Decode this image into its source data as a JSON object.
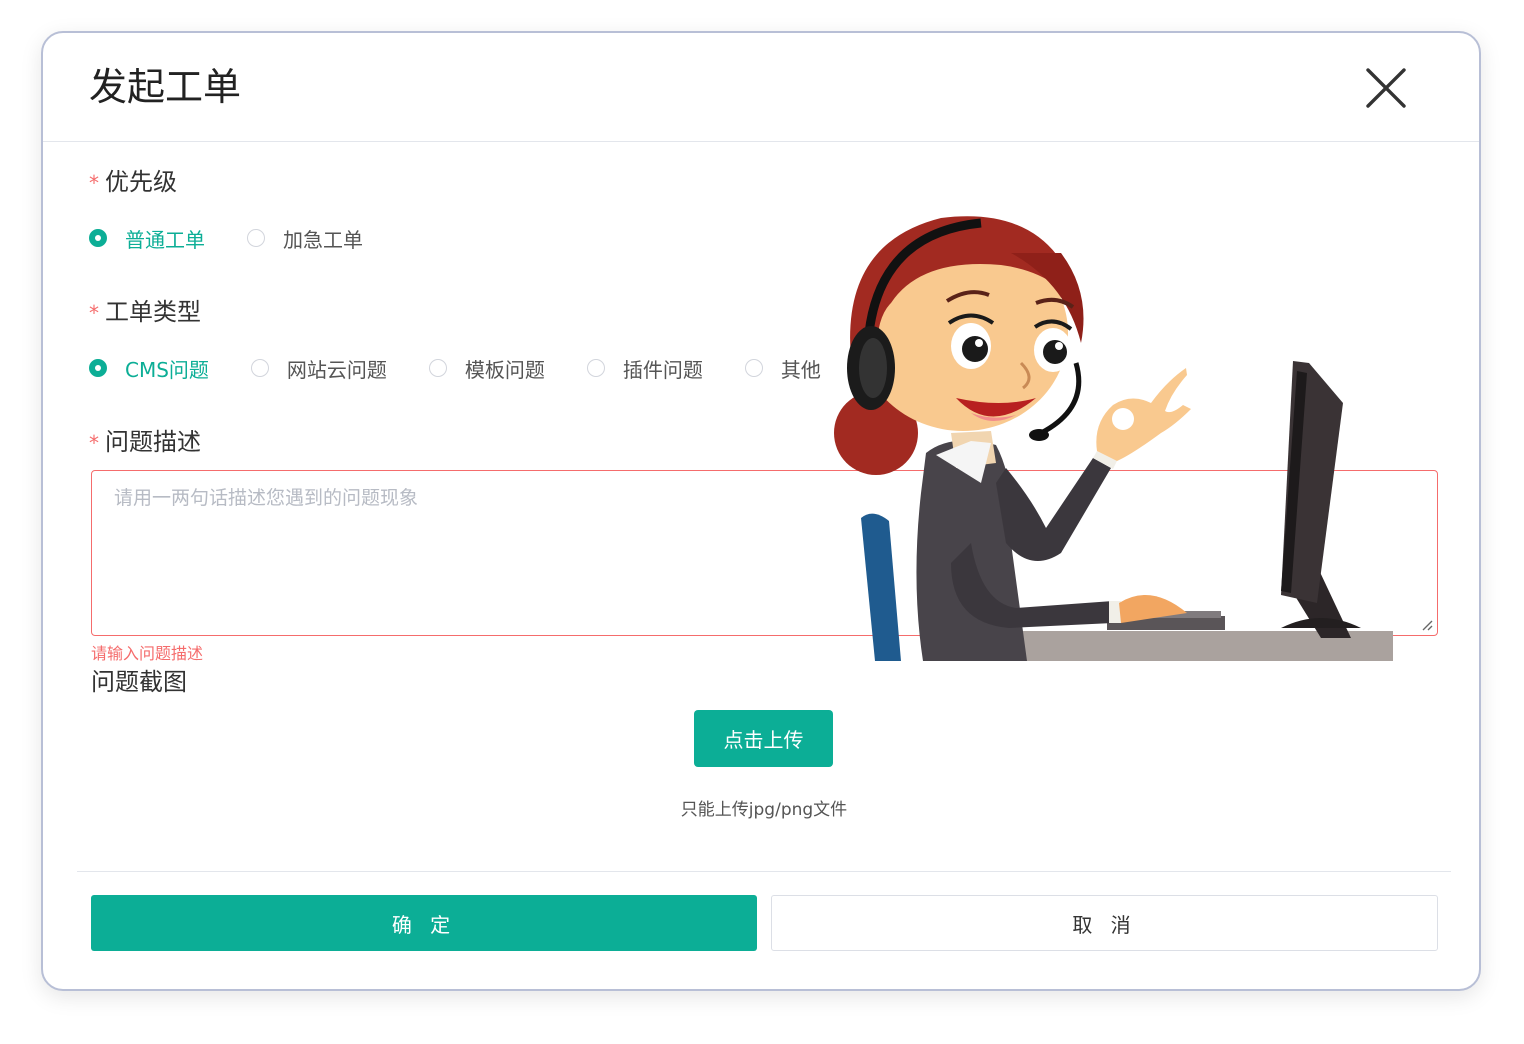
{
  "dialog": {
    "title": "发起工单"
  },
  "priority": {
    "label": "优先级",
    "options": [
      {
        "label": "普通工单",
        "checked": true
      },
      {
        "label": "加急工单",
        "checked": false
      }
    ]
  },
  "ticket_type": {
    "label": "工单类型",
    "options": [
      {
        "label": "CMS问题",
        "checked": true
      },
      {
        "label": "网站云问题",
        "checked": false
      },
      {
        "label": "模板问题",
        "checked": false
      },
      {
        "label": "插件问题",
        "checked": false
      },
      {
        "label": "其他",
        "checked": false
      }
    ]
  },
  "description": {
    "label": "问题描述",
    "placeholder": "请用一两句话描述您遇到的问题现象",
    "value": "",
    "error": "请输入问题描述"
  },
  "screenshot": {
    "label": "问题截图",
    "upload_label": "点击上传",
    "tip": "只能上传jpg/png文件"
  },
  "footer": {
    "confirm_label": "确 定",
    "cancel_label": "取 消"
  },
  "colors": {
    "accent": "#0cae96",
    "error": "#f56c6c",
    "border": "#b8bfd6"
  },
  "icons": {
    "close": "close-icon",
    "illustration": "customer-service-illustration"
  }
}
